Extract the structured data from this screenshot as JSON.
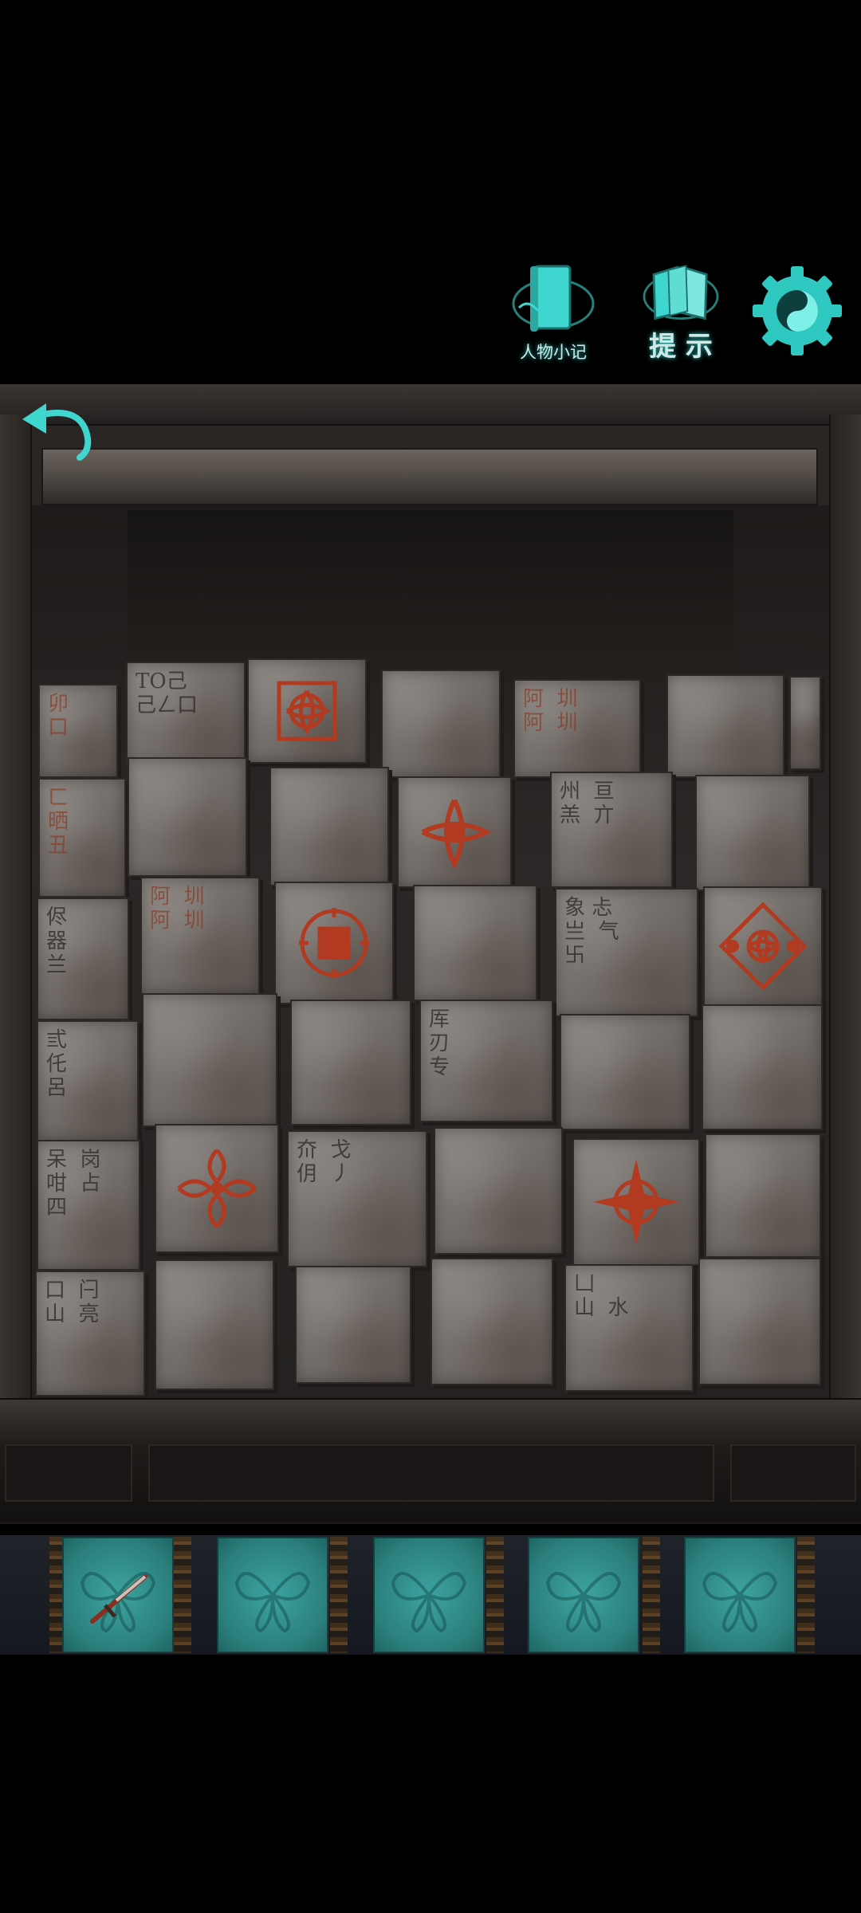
{
  "hud": {
    "notes_label": "人物小记",
    "hint_label": "提 示",
    "colors": {
      "accent": "#3fd6cf",
      "glow": "#2fd0c8"
    }
  },
  "blocks": [
    {
      "text": "卯\n口"
    },
    {
      "text": "TO己\n己ㄥ口"
    },
    {
      "motif": "red-flower-seal"
    },
    {
      "text": ""
    },
    {
      "text": "阿  圳\n阿  圳"
    },
    {
      "text": ""
    },
    {
      "text": "ㄈ\n晒\n丑"
    },
    {
      "text": ""
    },
    {
      "text": ""
    },
    {
      "motif": "red-cross-flower-seal"
    },
    {
      "text": "州  亘\n羔  亣"
    },
    {
      "text": ""
    },
    {
      "text": "侭\n器\n兰"
    },
    {
      "text": "阿  圳\n阿  圳"
    },
    {
      "motif": "red-square-seal"
    },
    {
      "text": ""
    },
    {
      "text": "象 忐\n亗  气\n卐"
    },
    {
      "motif": "red-diamond-flower-seal"
    },
    {
      "text": "弎\n仛\n呂"
    },
    {
      "text": ""
    },
    {
      "text": ""
    },
    {
      "text": "厍\n刃\n专"
    },
    {
      "text": ""
    },
    {
      "text": ""
    },
    {
      "text": "呆  岗\n咁  占\n四"
    },
    {
      "motif": "red-scroll-seal"
    },
    {
      "text": "夼  戈\n仴  丿"
    },
    {
      "text": ""
    },
    {
      "motif": "red-compass-seal"
    },
    {
      "text": ""
    },
    {
      "text": "口  闩\n山  亮"
    },
    {
      "text": ""
    },
    {
      "text": ""
    },
    {
      "text": ""
    },
    {
      "text": "凵\n山  水"
    },
    {
      "text": ""
    }
  ],
  "inventory": {
    "slots": [
      {
        "item": "sword"
      },
      {
        "item": "empty"
      },
      {
        "item": "empty"
      },
      {
        "item": "empty"
      },
      {
        "item": "empty"
      }
    ]
  }
}
